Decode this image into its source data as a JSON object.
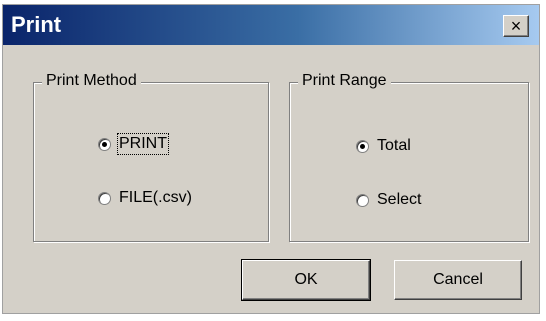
{
  "dialog": {
    "title": "Print",
    "close_label": "×"
  },
  "print_method": {
    "label": "Print Method",
    "options": [
      {
        "label": "PRINT",
        "selected": true
      },
      {
        "label": "FILE(.csv)",
        "selected": false
      }
    ]
  },
  "print_range": {
    "label": "Print Range",
    "options": [
      {
        "label": "Total",
        "selected": true
      },
      {
        "label": "Select",
        "selected": false
      }
    ]
  },
  "buttons": {
    "ok": "OK",
    "cancel": "Cancel"
  }
}
